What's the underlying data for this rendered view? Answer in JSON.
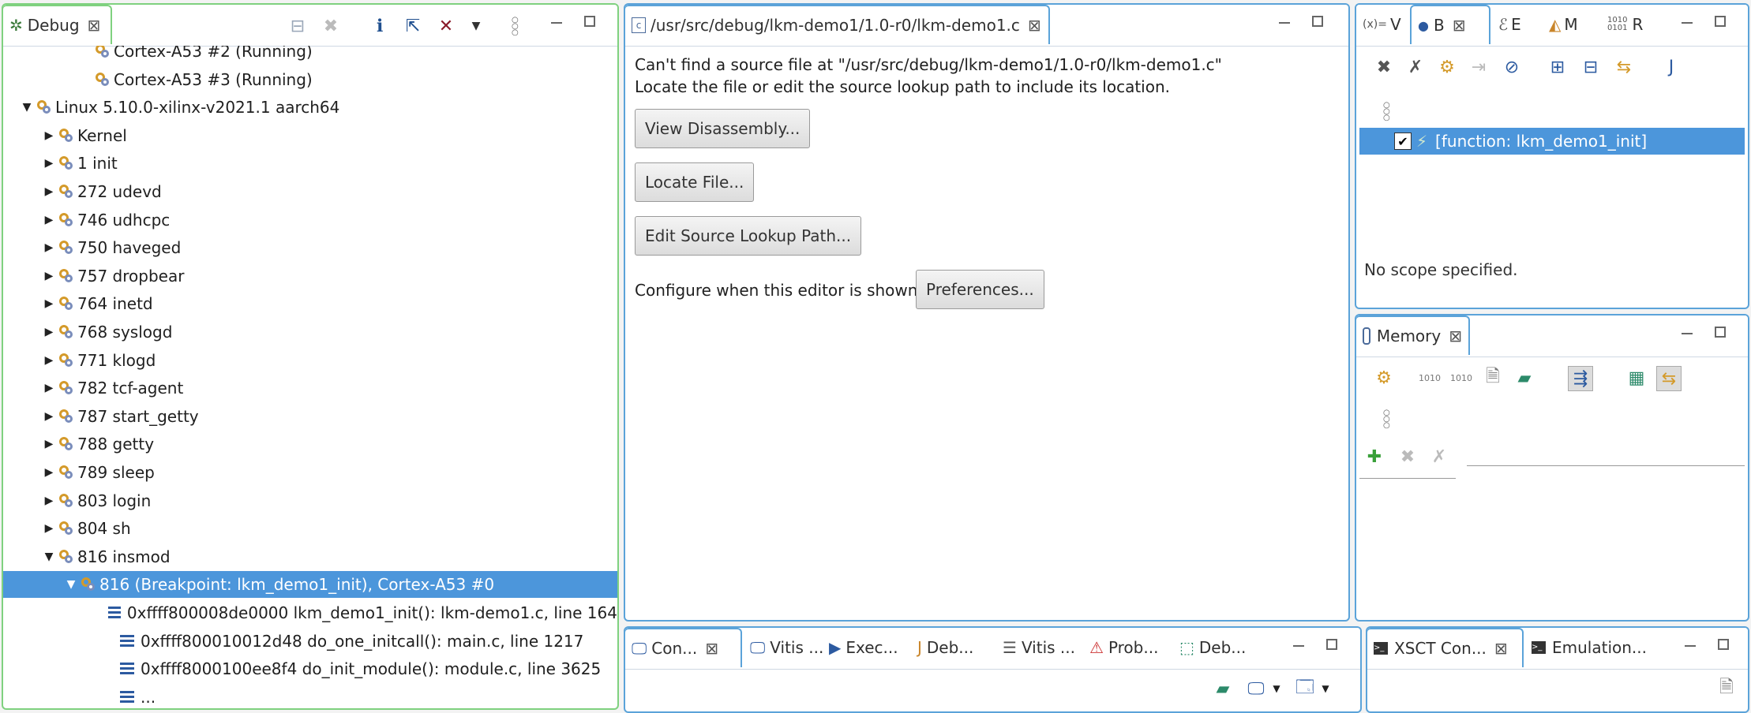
{
  "debug": {
    "tab_label": "Debug",
    "tree": [
      {
        "indent": 118,
        "twisty": "",
        "icon": "thread",
        "label": "Cortex-A53 #2 (Running)"
      },
      {
        "indent": 118,
        "twisty": "",
        "icon": "thread",
        "label": "Cortex-A53 #3 (Running)"
      },
      {
        "indent": 44,
        "twisty": "down",
        "icon": "process",
        "label": "Linux 5.10.0-xilinx-v2021.1 aarch64"
      },
      {
        "indent": 72,
        "twisty": "right",
        "icon": "process",
        "label": "Kernel"
      },
      {
        "indent": 72,
        "twisty": "right",
        "icon": "process",
        "label": "1 init"
      },
      {
        "indent": 72,
        "twisty": "right",
        "icon": "process",
        "label": "272 udevd"
      },
      {
        "indent": 72,
        "twisty": "right",
        "icon": "process",
        "label": "746 udhcpc"
      },
      {
        "indent": 72,
        "twisty": "right",
        "icon": "process",
        "label": "750 haveged"
      },
      {
        "indent": 72,
        "twisty": "right",
        "icon": "process",
        "label": "757 dropbear"
      },
      {
        "indent": 72,
        "twisty": "right",
        "icon": "process",
        "label": "764 inetd"
      },
      {
        "indent": 72,
        "twisty": "right",
        "icon": "process",
        "label": "768 syslogd"
      },
      {
        "indent": 72,
        "twisty": "right",
        "icon": "process",
        "label": "771 klogd"
      },
      {
        "indent": 72,
        "twisty": "right",
        "icon": "process",
        "label": "782 tcf-agent"
      },
      {
        "indent": 72,
        "twisty": "right",
        "icon": "process",
        "label": "787 start_getty"
      },
      {
        "indent": 72,
        "twisty": "right",
        "icon": "process",
        "label": "788 getty"
      },
      {
        "indent": 72,
        "twisty": "right",
        "icon": "process",
        "label": "789 sleep"
      },
      {
        "indent": 72,
        "twisty": "right",
        "icon": "process",
        "label": "803 login"
      },
      {
        "indent": 72,
        "twisty": "right",
        "icon": "process",
        "label": "804 sh"
      },
      {
        "indent": 72,
        "twisty": "down",
        "icon": "process",
        "label": "816 insmod"
      },
      {
        "indent": 100,
        "twisty": "down",
        "icon": "thread",
        "label": "816 (Breakpoint: lkm_demo1_init), Cortex-A53 #0",
        "selected": true
      },
      {
        "indent": 152,
        "twisty": "",
        "icon": "frame",
        "label": "0xffff800008de0000 lkm_demo1_init(): lkm-demo1.c, line 164"
      },
      {
        "indent": 152,
        "twisty": "",
        "icon": "frame",
        "label": "0xffff800010012d48 do_one_initcall(): main.c, line 1217"
      },
      {
        "indent": 152,
        "twisty": "",
        "icon": "frame",
        "label": "0xffff8000100ee8f4 do_init_module(): module.c, line 3625"
      },
      {
        "indent": 152,
        "twisty": "",
        "icon": "frame",
        "label": "..."
      }
    ]
  },
  "editor": {
    "tab_label": "/usr/src/debug/lkm-demo1/1.0-r0/lkm-demo1.c",
    "tab_icon": "c",
    "message_line1": "Can't find a source file at \"/usr/src/debug/lkm-demo1/1.0-r0/lkm-demo1.c\"",
    "message_line2": "Locate the file or edit the source lookup path to include its location.",
    "btn_disassembly": "View Disassembly...",
    "btn_locate": "Locate File...",
    "btn_edit_lookup": "Edit Source Lookup Path...",
    "configure_text": "Configure when this editor is shown",
    "btn_preferences": "Preferences..."
  },
  "right_top": {
    "tabs": [
      {
        "icon": "(x)=",
        "label": "V"
      },
      {
        "icon": "breakpoints",
        "label": "B"
      },
      {
        "icon": "expressions",
        "label": "E"
      },
      {
        "icon": "modules",
        "label": "M"
      },
      {
        "icon": "1010\n0101",
        "label": "R"
      }
    ],
    "breakpoint_item": "[function: lkm_demo1_init]",
    "no_scope": "No scope specified."
  },
  "memory": {
    "tab_label": "Memory"
  },
  "bottom_left": {
    "tabs": [
      "Con...",
      "Vitis ...",
      "Exec...",
      "Deb...",
      "Vitis ...",
      "Prob...",
      "Deb..."
    ]
  },
  "bottom_right": {
    "tabs": [
      "XSCT Con...",
      "Emulation..."
    ]
  },
  "colors": {
    "accent": "#5ba3d9",
    "active_view": "#7fd17f",
    "selection": "#4c96db"
  }
}
